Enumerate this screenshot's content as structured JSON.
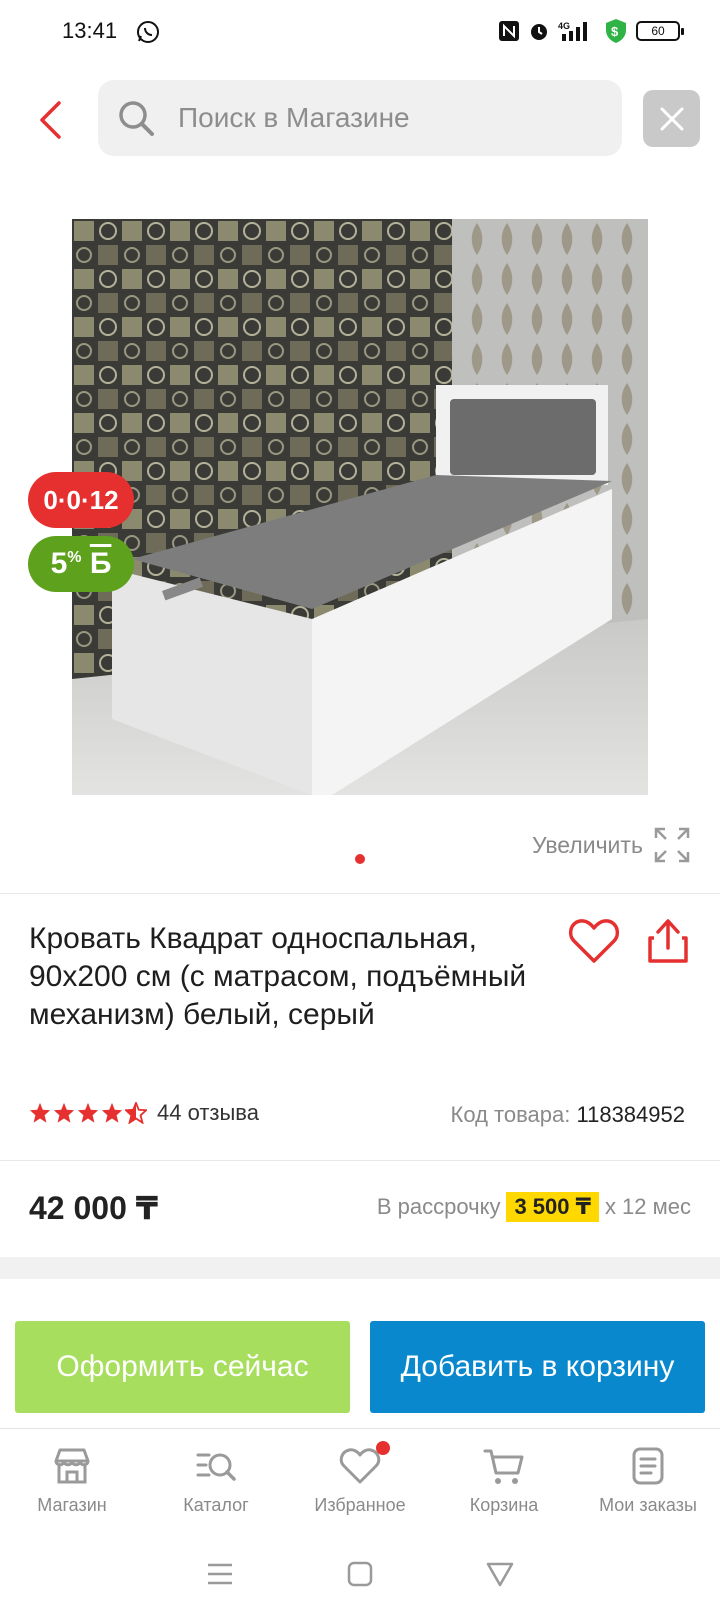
{
  "status_bar": {
    "time": "13:41",
    "network": "4G",
    "battery": "60",
    "icons": [
      "whatsapp-icon",
      "nfc-icon",
      "alarm-icon",
      "signal-icon",
      "security-icon",
      "battery-icon"
    ]
  },
  "header": {
    "search_placeholder": "Поиск в Магазине",
    "icons": [
      "back-arrow-icon",
      "search-icon",
      "close-icon"
    ]
  },
  "product": {
    "badge_installment": "0·0·12",
    "badge_bonus_value": "5",
    "badge_bonus_suffix": "%",
    "badge_bonus_symbol": "Б",
    "zoom_label": "Увеличить",
    "title": "Кровать Квадрат односпальная, 90x200 см (с матрасом, подъёмный механизм) белый, серый",
    "rating": 4.5,
    "reviews": "44 отзыва",
    "sku_label": "Код товара:",
    "sku_value": "118384952",
    "price": "42 000 ₸",
    "installment_label": "В рассрочку",
    "installment_amount": "3 500 ₸",
    "installment_term": "x 12 мес"
  },
  "actions": {
    "checkout_label": "Оформить сейчас",
    "cart_label": "Добавить в корзину"
  },
  "bottom_nav": {
    "items": [
      {
        "label": "Магазин",
        "icon": "shop-icon"
      },
      {
        "label": "Каталог",
        "icon": "catalog-icon"
      },
      {
        "label": "Избранное",
        "icon": "heart-icon"
      },
      {
        "label": "Корзина",
        "icon": "cart-icon"
      },
      {
        "label": "Мои заказы",
        "icon": "orders-icon"
      }
    ]
  },
  "colors": {
    "accent_red": "#e6302f",
    "bonus_green": "#5da11d",
    "checkout_green": "#a8de5e",
    "cart_blue": "#0a88cd",
    "installment_yellow": "#ffd800"
  }
}
